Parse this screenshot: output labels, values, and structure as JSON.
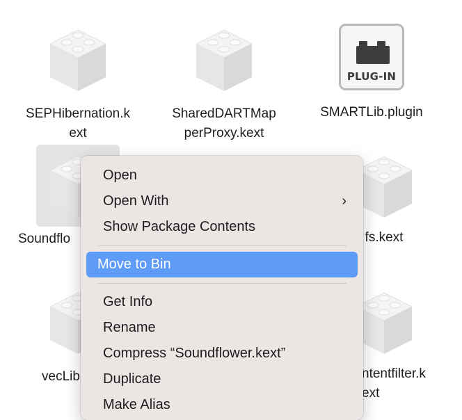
{
  "files": [
    {
      "name": "SEPHibernation.kext",
      "type": "kext"
    },
    {
      "name": "SharedDARTMapperProxy.kext",
      "type": "kext"
    },
    {
      "name": "SMARTLib.plugin",
      "type": "plugin",
      "badge": "PLUG-IN"
    },
    {
      "name": "Soundflower.kext",
      "type": "kext",
      "selected": true,
      "visible_label": "Soundflo"
    },
    {
      "name": "",
      "type": "kext",
      "visible_label": "fs.kext"
    },
    {
      "name": "",
      "type": "kext",
      "visible_label": "vecLib"
    },
    {
      "name": "",
      "type": "kext",
      "visible_label": "ntentfilter.k ext"
    }
  ],
  "labels": {
    "f0_line1": "SEPHibernation.k",
    "f0_line2": "ext",
    "f1_line1": "SharedDARTMap",
    "f1_line2": "perProxy.kext",
    "f2_line1": "SMARTLib.plugin",
    "f2_badge": "PLUG-IN",
    "f3_label": "Soundflo",
    "f4_label": "fs.kext",
    "f5_label": "vecLib",
    "f6_line1": "ntentfilter.k",
    "f6_line2": "ext"
  },
  "context_menu": {
    "items": [
      {
        "label": "Open"
      },
      {
        "label": "Open With",
        "submenu": true
      },
      {
        "label": "Show Package Contents"
      },
      {
        "label": "Move to Bin",
        "highlighted": true
      },
      {
        "label": "Get Info"
      },
      {
        "label": "Rename"
      },
      {
        "label": "Compress “Soundflower.kext”"
      },
      {
        "label": "Duplicate"
      },
      {
        "label": "Make Alias"
      }
    ],
    "submenu_chevron": "›"
  },
  "colors": {
    "selection_blue": "#0a63d8",
    "menu_highlight": "#5e9cf7",
    "menu_background": "#ebe6e3"
  }
}
